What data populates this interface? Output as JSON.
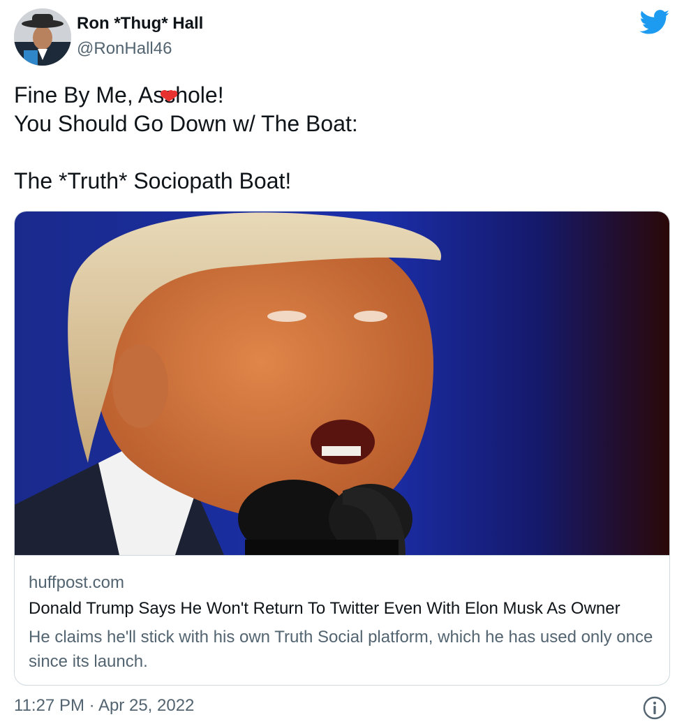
{
  "author": {
    "display_name": "Ron *Thug* Hall",
    "handle": "@RonHall46",
    "avatar_icon": "user-avatar-cowboy-hat"
  },
  "brand": {
    "logo_icon": "twitter-bird-icon",
    "accent_color": "#1d9bf0"
  },
  "tweet": {
    "line1_before": "Fine By Me, A",
    "line1_after": "hole!",
    "line2": "You Should Go Down w/ The Boat:",
    "line3": "The *Truth* Sociopath Boat!",
    "censor_icon": "red-heart-censor-icon"
  },
  "card": {
    "image_icon": "article-photo-speaker-at-microphone",
    "domain": "huffpost.com",
    "title": "Donald Trump Says He Won't Return To Twitter Even With Elon Musk As Owner",
    "description": "He claims he'll stick with his own Truth Social platform, which he has used only once since its launch."
  },
  "footer": {
    "timestamp": "11:27 PM · Apr 25, 2022",
    "info_icon": "info-icon"
  }
}
